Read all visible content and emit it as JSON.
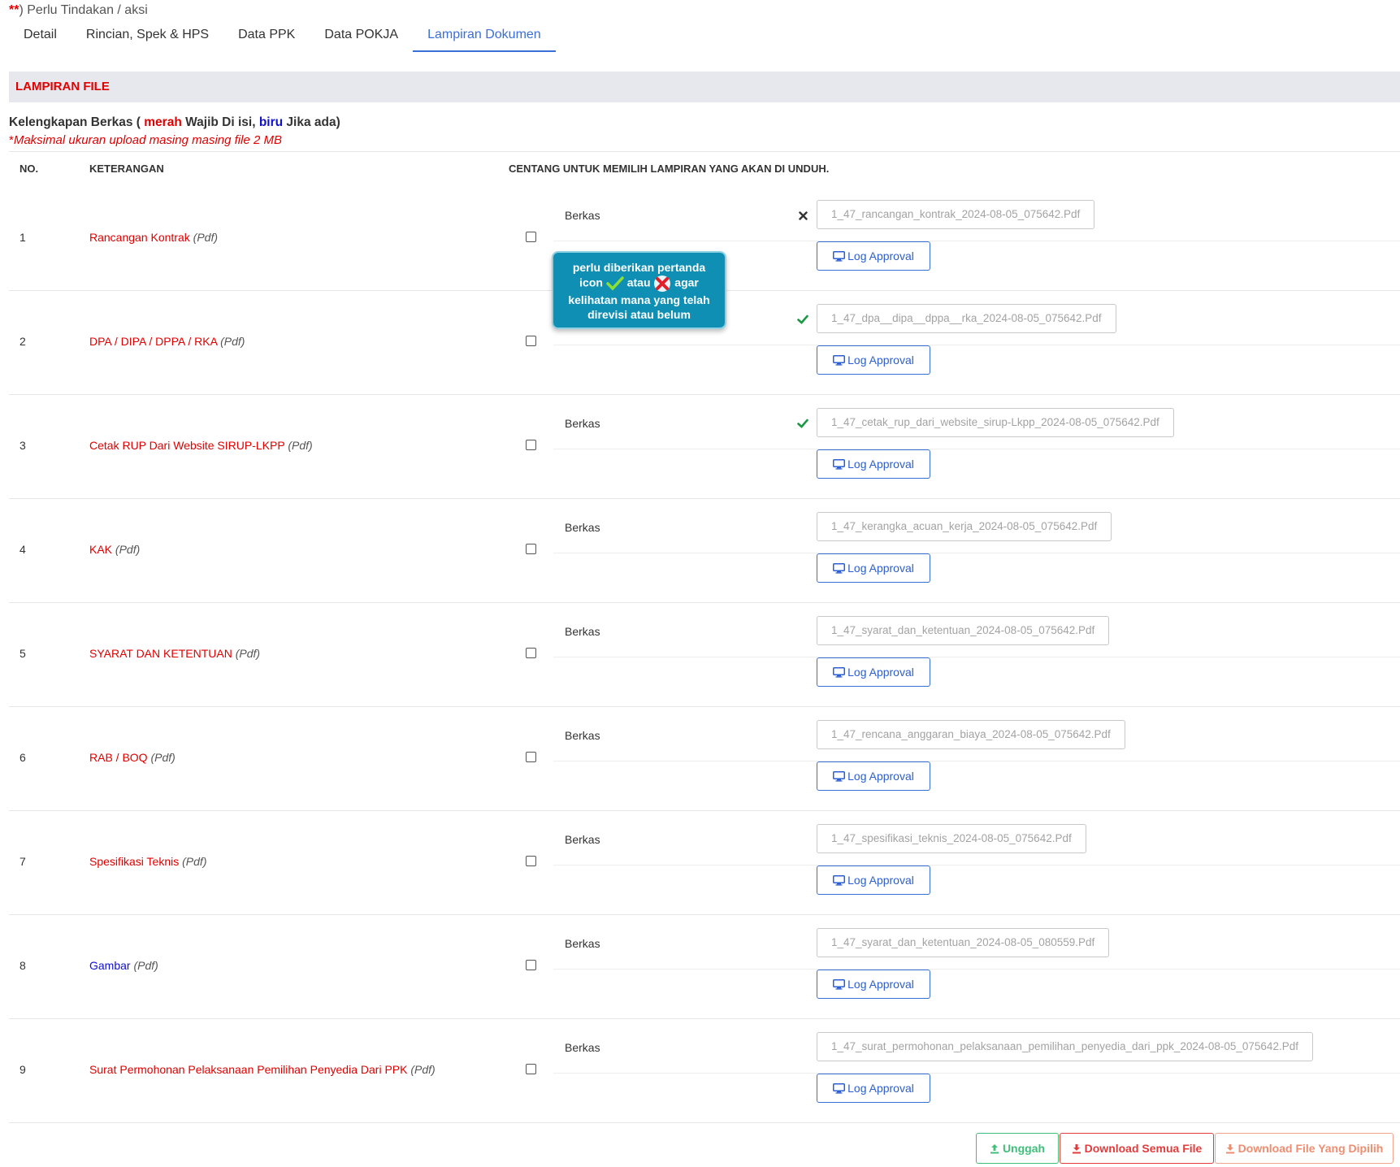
{
  "notice": {
    "stars": "**",
    "text": ") Perlu Tindakan / aksi"
  },
  "tabs": [
    {
      "label": "Detail"
    },
    {
      "label": "Rincian, Spek & HPS"
    },
    {
      "label": "Data PPK"
    },
    {
      "label": "Data POKJA"
    },
    {
      "label": "Lampiran Dokumen",
      "active": true
    }
  ],
  "section": {
    "title": "LAMPIRAN FILE"
  },
  "kelengkapan": {
    "prefix": "Kelengkapan Berkas ( ",
    "merah": "merah",
    "mid": " Wajib Di isi, ",
    "biru": "biru",
    "suffix": " Jika ada)",
    "max_star": "*",
    "max_note": "Maksimal ukuran upload masing masing file 2 MB"
  },
  "table": {
    "headers": {
      "no": "NO.",
      "keterangan": "KETERANGAN",
      "centang": "CENTANG UNTUK MEMILIH LAMPIRAN YANG AKAN DI UNDUH."
    },
    "berkas_label": "Berkas",
    "log_label": "Log Approval",
    "rows": [
      {
        "no": "1",
        "label": "Rancangan Kontrak",
        "type": "(Pdf)",
        "color": "red",
        "status": "cross",
        "file": "1_47_rancangan_kontrak_2024-08-05_075642.Pdf"
      },
      {
        "no": "2",
        "label": "DPA / DIPA / DPPA / RKA",
        "type": "(Pdf)",
        "color": "red",
        "status": "check",
        "file": "1_47_dpa__dipa__dppa__rka_2024-08-05_075642.Pdf"
      },
      {
        "no": "3",
        "label": "Cetak RUP Dari Website SIRUP-LKPP",
        "type": "(Pdf)",
        "color": "red",
        "status": "check",
        "file": "1_47_cetak_rup_dari_website_sirup-Lkpp_2024-08-05_075642.Pdf"
      },
      {
        "no": "4",
        "label": "KAK",
        "type": "(Pdf)",
        "color": "red",
        "status": "none",
        "file": "1_47_kerangka_acuan_kerja_2024-08-05_075642.Pdf"
      },
      {
        "no": "5",
        "label": "SYARAT DAN KETENTUAN",
        "type": "(Pdf)",
        "color": "red",
        "status": "none",
        "file": "1_47_syarat_dan_ketentuan_2024-08-05_075642.Pdf"
      },
      {
        "no": "6",
        "label": "RAB / BOQ",
        "type": "(Pdf)",
        "color": "red",
        "status": "none",
        "file": "1_47_rencana_anggaran_biaya_2024-08-05_075642.Pdf"
      },
      {
        "no": "7",
        "label": "Spesifikasi Teknis",
        "type": "(Pdf)",
        "color": "red",
        "status": "none",
        "file": "1_47_spesifikasi_teknis_2024-08-05_075642.Pdf"
      },
      {
        "no": "8",
        "label": "Gambar",
        "type": "(Pdf)",
        "color": "blue",
        "status": "none",
        "file": "1_47_syarat_dan_ketentuan_2024-08-05_080559.Pdf"
      },
      {
        "no": "9",
        "label": "Surat Permohonan Pelaksanaan Pemilihan Penyedia Dari PPK",
        "type": "(Pdf)",
        "color": "red",
        "status": "none",
        "file": "1_47_surat_permohonan_pelaksanaan_pemilihan_penyedia_dari_ppk_2024-08-05_075642.Pdf"
      }
    ]
  },
  "tooltip": {
    "line1": "perlu diberikan pertanda",
    "icon_word": "icon",
    "atau": "atau",
    "agar": "agar",
    "line3": "kelihatan mana yang telah",
    "line4": "direvisi atau belum"
  },
  "buttons": {
    "unggah": "Unggah",
    "download_all": "Download Semua File",
    "download_selected": "Download File Yang Dipilih"
  },
  "colors": {
    "accent": "#3a6fd8",
    "required_red": "#e00000",
    "optional_blue": "#1010d0",
    "status_check": "#1a9a45",
    "tooltip_bg": "#0f8fb3"
  }
}
